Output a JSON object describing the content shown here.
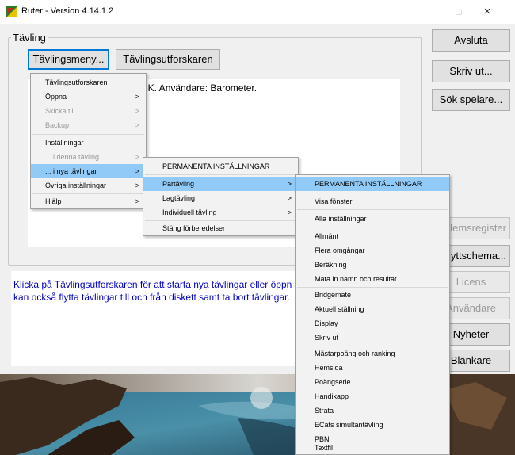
{
  "window": {
    "title": "Ruter - Version 4.14.1.2",
    "minimize": "–",
    "maximize": "□",
    "close": "×"
  },
  "group": {
    "title": "Tävling",
    "menu_button": "Tävlingsmeny...",
    "explorer_button": "Tävlingsutforskaren",
    "panel_text": "3K. Användare: Barometer."
  },
  "info": {
    "line1": "Klicka på Tävlingsutforskaren för att starta nya tävlingar eller öppn",
    "line2": "kan också flytta tävlingar till och från diskett samt ta bort tävlingar."
  },
  "right_buttons": {
    "avsluta": "Avsluta",
    "skrivut": "Skriv ut...",
    "sokspelare": "Sök spelare...",
    "medlemsregister": "dlemsregister",
    "flyttschema": "yttschema...",
    "licens": "Licens",
    "anvandare": "Användare",
    "nyheter": "Nyheter",
    "blankare": "Blänkare"
  },
  "menu1": {
    "items": [
      {
        "label": "Tävlingsutforskaren"
      },
      {
        "label": "Öppna",
        "arrow": ">"
      },
      {
        "label": "Skicka till",
        "arrow": ">"
      },
      {
        "label": "Backup",
        "arrow": ">"
      },
      {
        "label": "Inställningar"
      },
      {
        "label": "... i denna tävling",
        "arrow": ">"
      },
      {
        "label": "... i nya tävlingar",
        "arrow": ">"
      },
      {
        "label": "Övriga inställningar",
        "arrow": ">"
      },
      {
        "label": "Hjälp",
        "arrow": ">"
      }
    ]
  },
  "menu2": {
    "items": [
      {
        "label": "PERMANENTA INSTÄLLNINGAR"
      },
      {
        "label": "Partävling",
        "arrow": ">"
      },
      {
        "label": "Lagtävling",
        "arrow": ">"
      },
      {
        "label": "Individuell tävling",
        "arrow": ">"
      },
      {
        "label": "Stäng förberedelser"
      }
    ]
  },
  "menu3": {
    "items": [
      {
        "label": "PERMANENTA INSTÄLLNINGAR"
      },
      {
        "label": "Visa fönster"
      },
      {
        "label": "Alla inställningar"
      },
      {
        "label": "Allmänt"
      },
      {
        "label": "Flera omgångar"
      },
      {
        "label": "Beräkning"
      },
      {
        "label": "Mata in namn och resultat"
      },
      {
        "label": "Bridgemate"
      },
      {
        "label": "Aktuell ställning"
      },
      {
        "label": "Display"
      },
      {
        "label": "Skriv ut"
      },
      {
        "label": "Mästarpoäng och ranking"
      },
      {
        "label": "Hemsida"
      },
      {
        "label": "Poängserie"
      },
      {
        "label": "Handikapp"
      },
      {
        "label": "Strata"
      },
      {
        "label": "ECats simultantävling"
      },
      {
        "label": "PBN"
      },
      {
        "label": "Textfil"
      }
    ]
  }
}
